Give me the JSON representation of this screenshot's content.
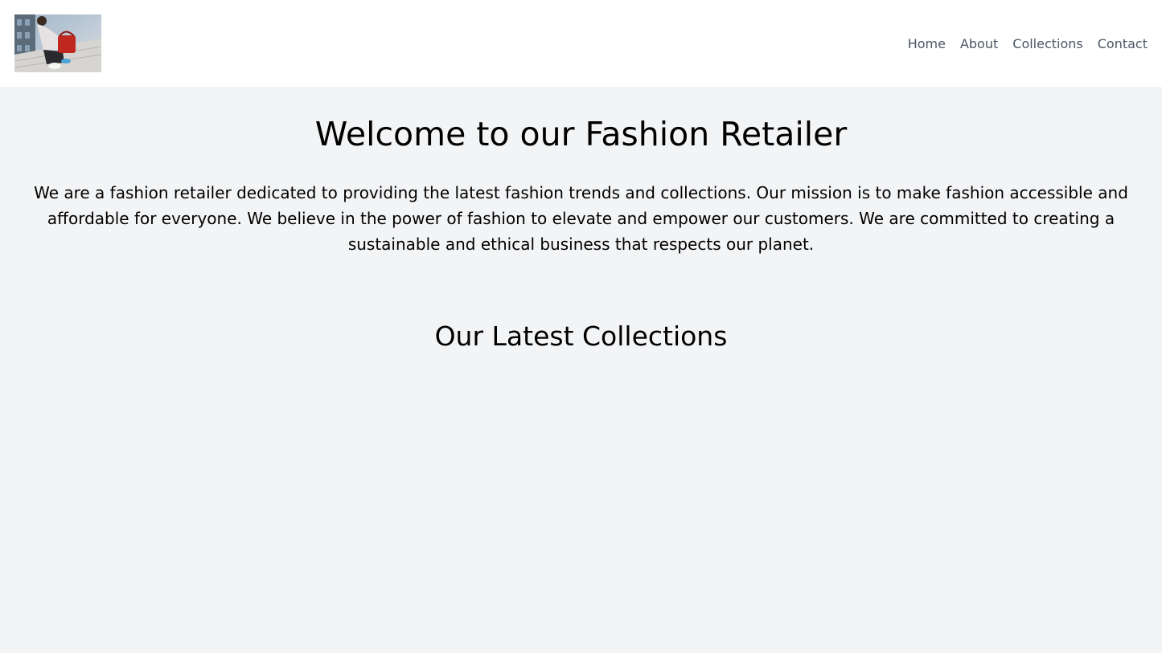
{
  "header": {
    "logo_alt": "Fashion photo logo",
    "nav": [
      {
        "label": "Home"
      },
      {
        "label": "About"
      },
      {
        "label": "Collections"
      },
      {
        "label": "Contact"
      }
    ]
  },
  "main": {
    "title": "Welcome to our Fashion Retailer",
    "mission": "We are a fashion retailer dedicated to providing the latest fashion trends and collections. Our mission is to make fashion accessible and affordable for everyone. We believe in the power of fashion to elevate and empower our customers. We are committed to creating a sustainable and ethical business that respects our planet.",
    "collections_heading": "Our Latest Collections"
  },
  "colors": {
    "page_background": "#f3f4f6",
    "header_background": "#ffffff",
    "nav_text": "#4b5563",
    "body_text": "#000000"
  }
}
